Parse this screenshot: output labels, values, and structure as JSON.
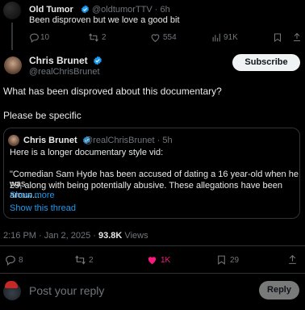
{
  "parent_tweet": {
    "name": "Old Tumor",
    "handle": "@oldtumorTTV",
    "time": "6h",
    "text": "Been disproven but we love a good bit",
    "replies": "10",
    "reposts": "2",
    "likes": "554",
    "views": "91K"
  },
  "main_tweet": {
    "name": "Chris Brunet",
    "handle": "@realChrisBrunet",
    "subscribe_label": "Subscribe",
    "text_line1": "What has been disproved about this documentary?",
    "text_line2": "Please be specific",
    "timestamp": "2:16 PM · Jan 2, 2025 · ",
    "views_count": "93.8K",
    "views_label": " Views",
    "replies": "8",
    "reposts": "2",
    "likes": "1K",
    "bookmarks": "29"
  },
  "quote_tweet": {
    "name": "Chris Brunet",
    "handle": "@realChrisBrunet",
    "time": "5h",
    "line1": "Here is a longer documentary style vid:",
    "line2": "\"Comedian Sam Hyde has been accused of dating a 16 year-old when he was",
    "line3": "29, along with being potentially abusive.  These allegations have been aroun...",
    "show_more": "Show more",
    "show_thread": "Show this thread"
  },
  "reply_box": {
    "placeholder": "Post your reply",
    "button_label": "Reply"
  },
  "colors": {
    "background": "#000000",
    "text": "#e7e9ea",
    "muted": "#71767b",
    "link": "#1d9bf0",
    "like": "#f91880",
    "verified": "#1d9bf0"
  }
}
